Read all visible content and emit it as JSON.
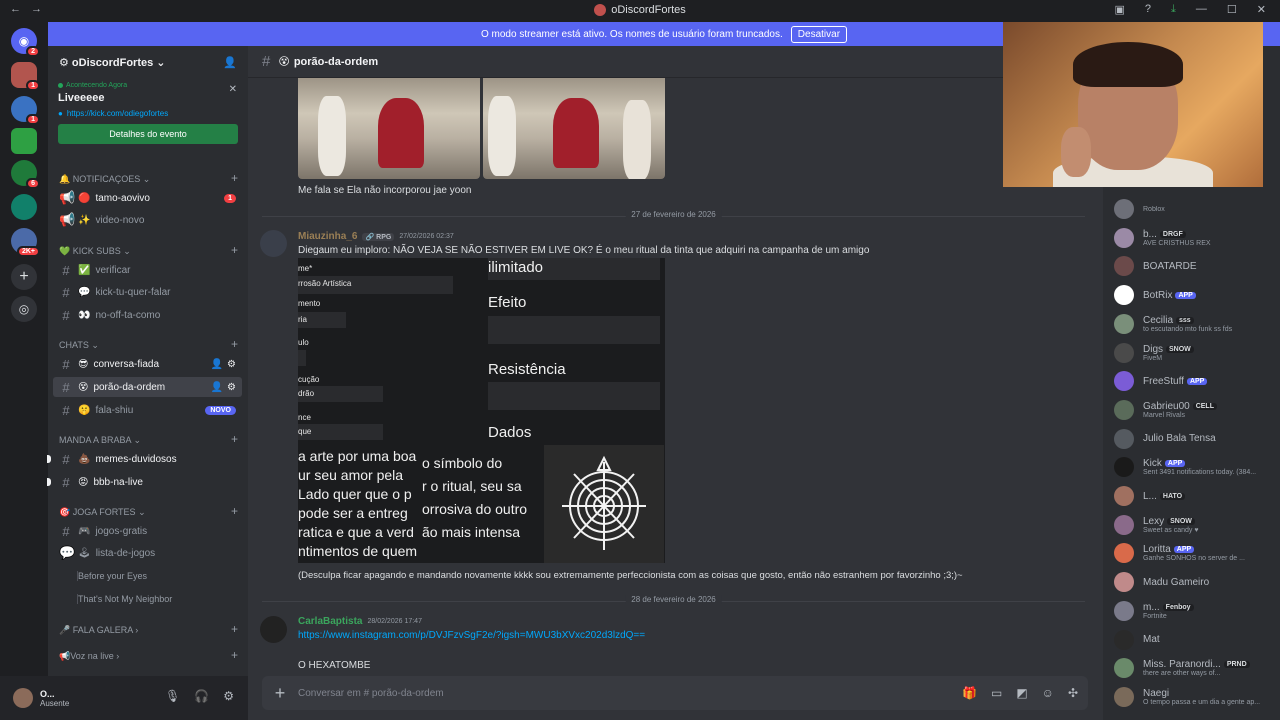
{
  "window": {
    "title": "oDiscordFortes"
  },
  "banner": {
    "text": "O modo streamer está ativo. Os nomes de usuário foram truncados.",
    "button": "Desativar"
  },
  "servers": {
    "badges": [
      "2",
      "1",
      "1",
      "6",
      "2K+"
    ]
  },
  "sidebar": {
    "server_name": "oDiscordFortes",
    "event": {
      "status": "Acontecendo Agora",
      "name": "Liveeeee",
      "url": "https://kick.com/odiegofortes",
      "button": "Detalhes do evento"
    },
    "categories": {
      "notificacoes": "NOTIFICAÇOES",
      "kick_subs": "KICK SUBS",
      "chats": "CHATS",
      "manda_a_braba": "MANDA A BRABA",
      "joga_fortes": "JOGA FORTES",
      "fala_galera": "FALA GALERA",
      "voz_na_live": "Voz na live"
    },
    "channels": {
      "tamo_aovivo": "tamo-aovivo",
      "tamo_aovivo_badge": "1",
      "video_novo": "video-novo",
      "verificar": "verificar",
      "kick_tu_quer_falar": "kick-tu-quer-falar",
      "no_off_ta_como": "no-off-ta-como",
      "conversa_fiada": "conversa-fiada",
      "porao_da_ordem": "porão-da-ordem",
      "fala_shiu": "fala-shiu",
      "fala_shiu_badge": "NOVO",
      "memes_duvidosos": "memes-duvidosos",
      "bbb_na_live": "bbb-na-live",
      "jogos_gratis": "jogos-gratis",
      "lista_de_jogos": "lista-de-jogos"
    },
    "threads": [
      "Before your Eyes",
      "That's Not My Neighbor"
    ]
  },
  "user": {
    "name": "O...",
    "status": "Ausente"
  },
  "channel_header": {
    "name": "porão-da-ordem"
  },
  "messages": {
    "caption": "Me fala se Ela não incorporou jae yoon",
    "date1": "27 de fevereiro de 2026",
    "msg1": {
      "author": "Miauzinha_6",
      "tag": "RPG",
      "time": "27/02/2026 02:37",
      "text": "Diegaum eu imploro: NÃO VEJA SE NÃO ESTIVER EM LIVE OK? É o meu ritual da tinta que adquiri na campanha de um amigo",
      "followup": "(Desculpa ficar apagando e mandando novamente kkkk sou extremamente perfeccionista com as coisas que gosto, então não estranhem por favorzinho ;3;)~"
    },
    "sheet": {
      "small": [
        "me*",
        "rrosão Artística",
        "mento",
        "ria",
        "ulo",
        "cução",
        "drão",
        "nce",
        "que"
      ],
      "big": [
        "ilimitado",
        "Efeito",
        "Resistência",
        "Dados"
      ],
      "para_left": [
        "a arte por uma boa",
        "ur seu amor pela",
        "Lado quer que o p",
        "pode ser a entreg",
        "ratica e que a verd",
        "ntimentos de quem"
      ],
      "para_mid": [
        "o símbolo do",
        "r o ritual, seu sa",
        "orrosiva do outro",
        "ão mais intensa"
      ]
    },
    "date2": "28 de fevereiro de 2026",
    "msg2": {
      "author": "CarlaBaptista",
      "time": "28/02/2026 17:47",
      "link": "https://www.instagram.com/p/DVJFzvSgF2e/?igsh=MWU3bXVxc202d3lzdQ==",
      "text": "O HEXATOMBE"
    }
  },
  "composer": {
    "placeholder": "Conversar em #  porão-da-ordem"
  },
  "members": [
    {
      "name": "",
      "sub": "Roblox",
      "color": "#6d6f78"
    },
    {
      "name": "b...",
      "tag": "DRGF",
      "sub": "AVE CRISTHUS REX",
      "color": "#9b8aa6"
    },
    {
      "name": "BOATARDE",
      "sub": "",
      "color": "#6b4a4a"
    },
    {
      "name": "BotRix",
      "tag": "APP",
      "sub": "",
      "color": "#ffffff"
    },
    {
      "name": "Cecilia",
      "tag": "sss",
      "sub": "to escutando mto funk ss fds",
      "color": "#7a8f7a"
    },
    {
      "name": "Digs",
      "tag": "SNOW",
      "sub": "FiveM",
      "color": "#4a4a4a"
    },
    {
      "name": "FreeStuff",
      "tag": "APP",
      "sub": "",
      "color": "#7b5cd6"
    },
    {
      "name": "Gabrieu00",
      "tag": "CELL",
      "sub": "Marvel Rivals",
      "color": "#5a6b5a"
    },
    {
      "name": "Julio Bala Tensa",
      "sub": "",
      "color": "#555a60"
    },
    {
      "name": "Kick",
      "tag": "APP",
      "sub": "Sent 3491 notifications today. (384...",
      "color": "#1a1a1a"
    },
    {
      "name": "L...",
      "tag": "HATO",
      "sub": "",
      "color": "#a07060"
    },
    {
      "name": "Lexy",
      "tag": "SNOW",
      "sub": "Sweet as candy ♥",
      "color": "#8a6a8a"
    },
    {
      "name": "Loritta",
      "tag": "APP",
      "sub": "Ganhe SONHOS no server de ...",
      "color": "#d96a4a"
    },
    {
      "name": "Madu Gameiro",
      "sub": "",
      "color": "#c08a8a"
    },
    {
      "name": "m...",
      "tag": "Fenboy",
      "sub": "Fortnite",
      "color": "#7a7a8a"
    },
    {
      "name": "Mat",
      "sub": "",
      "color": "#2a2a2a"
    },
    {
      "name": "Miss. Paranordi...",
      "tag": "PRND",
      "sub": "there are other ways of...",
      "color": "#6a8a6a"
    },
    {
      "name": "Naegi",
      "sub": "O tempo passa e um dia a gente ap...",
      "color": "#7a6a5a"
    }
  ]
}
